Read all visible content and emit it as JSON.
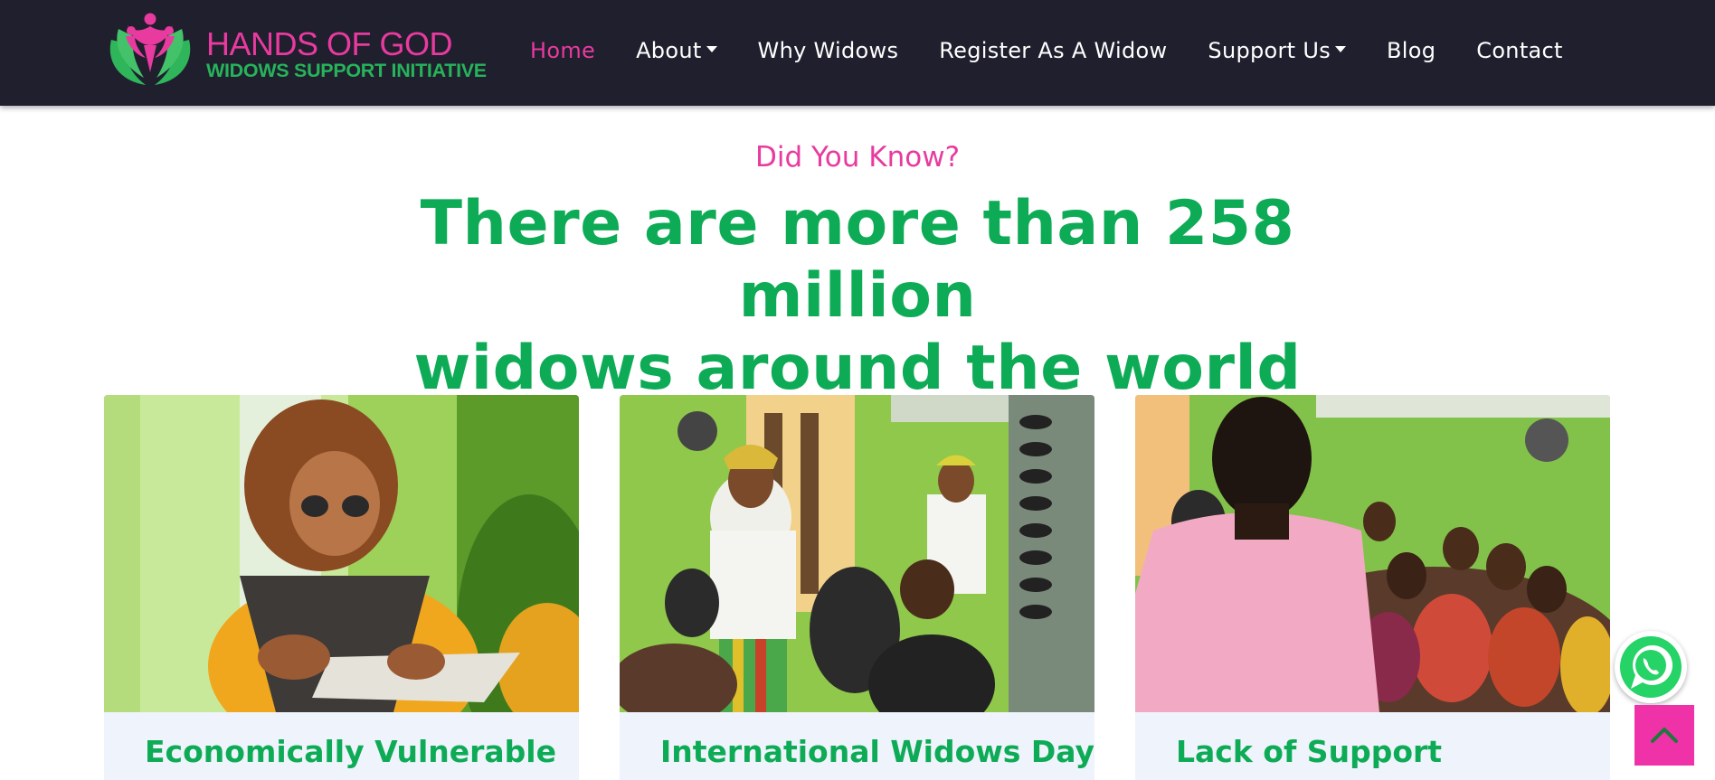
{
  "navbar": {
    "logo": {
      "title": "HANDS OF GOD",
      "subtitle": "WIDOWS SUPPORT INITIATIVE",
      "icon": "lotus-people-icon"
    },
    "items": [
      {
        "label": "Home",
        "active": true
      },
      {
        "label": "About",
        "dropdown": true
      },
      {
        "label": "Why Widows"
      },
      {
        "label": "Register As A Widow"
      },
      {
        "label": "Support Us",
        "dropdown": true
      },
      {
        "label": "Blog"
      },
      {
        "label": "Contact"
      }
    ]
  },
  "hero": {
    "eyebrow": "Did You Know?",
    "headline_line1": "There are more than 258 million",
    "headline_line2": "widows around the world"
  },
  "cards": [
    {
      "title": "Economically Vulnerable",
      "image_icon": "woman-reading-card-photo"
    },
    {
      "title": "International Widows Day",
      "image_icon": "widows-optical-clinic-photo"
    },
    {
      "title": "Lack of Support",
      "image_icon": "widows-gathering-photo"
    }
  ],
  "floating": {
    "whatsapp_icon": "whatsapp-icon",
    "back_to_top_icon": "chevron-up-icon"
  },
  "colors": {
    "nav_bg": "#1f1f2e",
    "accent_pink": "#e83a9f",
    "accent_green": "#0eab56",
    "card_bg": "#eef3fc",
    "back_to_top_bg": "#f032a8",
    "whatsapp_green": "#25d366"
  }
}
